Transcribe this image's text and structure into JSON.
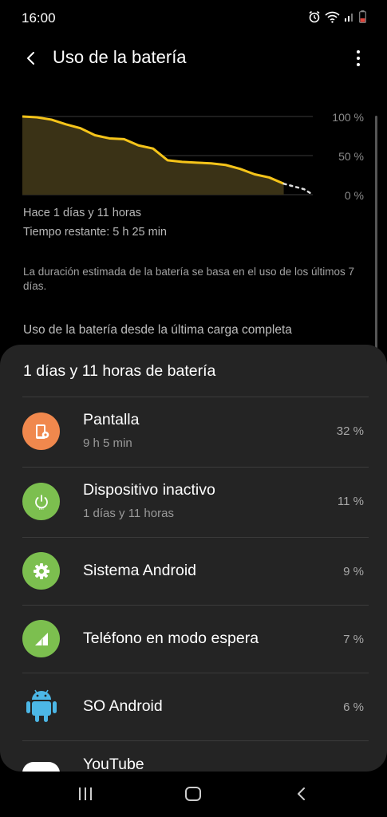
{
  "status": {
    "time": "16:00",
    "icons": [
      "alarm-icon",
      "wifi-icon",
      "signal-icon",
      "battery-icon"
    ]
  },
  "appbar": {
    "title": "Uso de la batería",
    "back_icon": "back-arrow-icon",
    "more_icon": "more-vert-icon"
  },
  "chart_data": {
    "type": "area",
    "title": "",
    "xlabel": "",
    "ylabel": "",
    "ylim": [
      0,
      100
    ],
    "y_ticks": [
      "100 %",
      "50 %",
      "0 %"
    ],
    "grid": true,
    "x": [
      0,
      0.05,
      0.1,
      0.15,
      0.2,
      0.25,
      0.3,
      0.35,
      0.4,
      0.45,
      0.5,
      0.55,
      0.6,
      0.65,
      0.7,
      0.75,
      0.8,
      0.85,
      0.9
    ],
    "series": [
      {
        "values": [
          100,
          99,
          96,
          90,
          85,
          76,
          72,
          71,
          63,
          59,
          44,
          42,
          41,
          40,
          38,
          33,
          26,
          22,
          14
        ],
        "color": "#f5c41a"
      }
    ],
    "projection": {
      "x": [
        0.9,
        0.97,
        1.0
      ],
      "values": [
        14,
        7,
        0
      ],
      "style": "dotted",
      "color": "#dddddd"
    },
    "fill_color": "#3a3216"
  },
  "info": {
    "since": "Hace 1 días y 11 horas",
    "remaining": "Tiempo restante: 5 h 25 min",
    "note": "La duración estimada de la batería se basa en el uso de los últimos 7 días.",
    "section": "Uso de la batería desde la última carga completa"
  },
  "card": {
    "title": "1 días y 11 horas de batería",
    "items": [
      {
        "name": "Pantalla",
        "sub": "9 h 5 min",
        "pct": "32 %",
        "icon": "screen-settings-icon",
        "color": "#f0884d"
      },
      {
        "name": "Dispositivo inactivo",
        "sub": "1 días y 11 horas",
        "pct": "11 %",
        "icon": "power-icon",
        "color": "#7cbf4f"
      },
      {
        "name": "Sistema Android",
        "sub": "",
        "pct": "9 %",
        "icon": "gear-icon",
        "color": "#7cbf4f"
      },
      {
        "name": "Teléfono en modo espera",
        "sub": "",
        "pct": "7 %",
        "icon": "signal-bars-icon",
        "color": "#7cbf4f"
      },
      {
        "name": "SO Android",
        "sub": "",
        "pct": "6 %",
        "icon": "android-robot-icon",
        "color": "#4cb7e6"
      },
      {
        "name": "YouTube",
        "sub": "",
        "pct": "",
        "icon": "youtube-icon",
        "color": "#ffffff"
      }
    ]
  },
  "nav": {
    "recents_icon": "recents-icon",
    "home_icon": "home-icon",
    "back_icon": "nav-back-icon"
  }
}
